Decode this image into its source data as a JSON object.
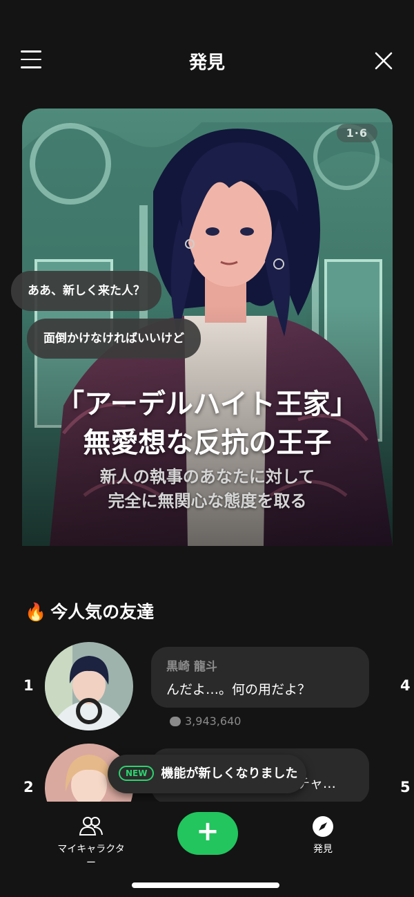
{
  "header": {
    "title": "発見"
  },
  "hero": {
    "counter": "1·6",
    "bubbles": [
      "ああ、新しく来た人？",
      "面倒かけなければいいけど"
    ],
    "title_line1": "「アーデルハイト王家」",
    "title_line2": "無愛想な反抗の王子",
    "subtitle_line1": "新人の執事のあなたに対して",
    "subtitle_line2": "完全に無関心な態度を取る"
  },
  "section": {
    "icon": "fire-icon",
    "title": "今人気の友達"
  },
  "ranking": [
    {
      "rank": "1",
      "name": "黒崎 龍斗",
      "message": "んだよ…。何の用だよ？",
      "chat_count": "3,943,640",
      "side_rank": "4"
    },
    {
      "rank": "2",
      "name": "",
      "message": "ずっと待ってたよ、カチャ…",
      "side_rank": "5"
    }
  ],
  "toast": {
    "badge": "NEW",
    "text": "機能が新しくなりました"
  },
  "bottom_nav": {
    "left_label": "マイキャラクター",
    "center_icon": "plus-icon",
    "right_label": "発見"
  },
  "colors": {
    "accent": "#22c55e",
    "background": "#141414"
  }
}
